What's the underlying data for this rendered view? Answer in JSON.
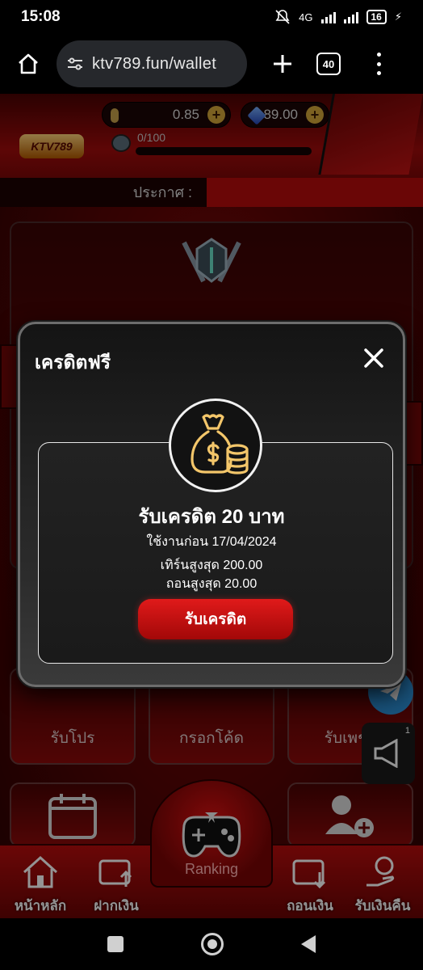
{
  "status_bar": {
    "time": "15:08",
    "network": "4G",
    "battery": "16"
  },
  "browser": {
    "url": "ktv789.fun/wallet",
    "tab_count": "40"
  },
  "header": {
    "logo_text": "KTV789",
    "coin_balance": "0.85",
    "gem_balance": "89.00",
    "xp_text": "0/100",
    "xp_progress": 0,
    "announcement_label": "ประกาศ :"
  },
  "tiles": {
    "promo": "รับโปร",
    "code": "กรอกโค้ด",
    "diamond": "รับเพชร",
    "megaphone_badge": "1"
  },
  "bottom_nav": {
    "home": "หน้าหลัก",
    "deposit": "ฝากเงิน",
    "ranking": "Ranking",
    "withdraw": "ถอนเงิน",
    "cashback": "รับเงินคืน"
  },
  "modal": {
    "title": "เครดิตฟรี",
    "credit_title": "รับเครดิต 20 บาท",
    "use_before": "ใช้งานก่อน 17/04/2024",
    "max_turnover": "เทิร์นสูงสุด 200.00",
    "max_withdraw": "ถอนสูงสุด 20.00",
    "claim_button": "รับเครดิต"
  },
  "colors": {
    "accent_red": "#c40d0d",
    "gold": "#d4a83a",
    "modal_bg": "#1e1e1e"
  }
}
